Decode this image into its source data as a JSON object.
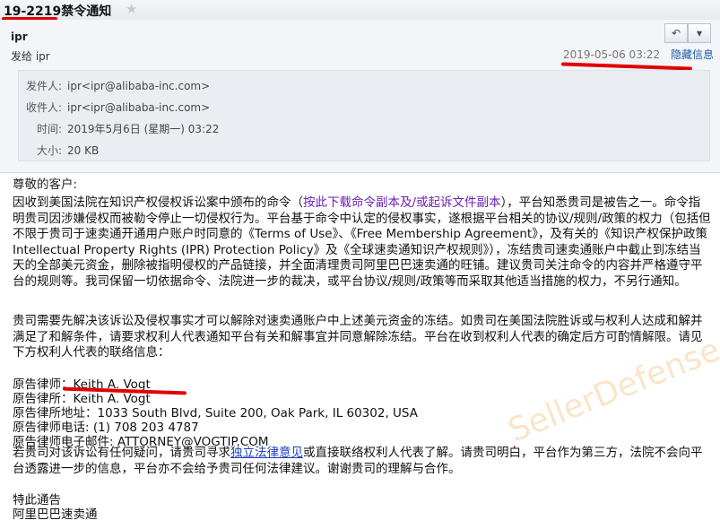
{
  "subject": "19-2219禁令通知",
  "sender_name": "ipr",
  "from_label": "发给 ipr",
  "date_short": "2019-05-06 03:22",
  "hide_info": "隐藏信息",
  "details": {
    "from_key": "发件人:",
    "from_val": "ipr<ipr@alibaba-inc.com>",
    "to_key": "收件人:",
    "to_val": "ipr<ipr@alibaba-inc.com>",
    "time_key": "时间:",
    "time_val": "2019年5月6日 (星期一) 03:22",
    "size_key": "大小:",
    "size_val": "20 KB"
  },
  "greeting": "尊敬的客户:",
  "para1_a": "因收到美国法院在知识产权侵权诉讼案中颁布的命令（",
  "para1_link": "按此下载命令副本及/或起诉文件副本",
  "para1_b": "），平台知悉贵司是被告之一。命令指明贵司因涉嫌侵权而被勒令停止一切侵权行为。平台基于命令中认定的侵权事实，遂根据平台相关的协议/规则/政策的权力（包括但不限于贵司于速卖通开通用户账户时同意的《Terms of Use》、《Free Membership Agreement》，及有关的《知识产权保护政策Intellectual Property Rights (IPR) Protection Policy》及《全球速卖通知识产权规则》），冻结贵司速卖通账户中截止到冻结当天的全部美元资金，删除被指明侵权的产品链接，并全面清理贵司阿里巴巴速卖通的旺铺。建议贵司关注命令的内容并严格遵守平台的规则等。我司保留一切依据命令、法院进一步的裁决，或平台协议/规则/政策等而采取其他适当措施的权力，不另行通知。",
  "para2": "贵司需要先解决该诉讼及侵权事实才可以解除对速卖通账户中上述美元资金的冻结。如贵司在美国法院胜诉或与权利人达成和解并满足了和解条件，请要求权利人代表通知平台有关和解事宜并同意解除冻结。平台在收到权利人代表的确定后方可酌情解限。请见下方权利人代表的联络信息：",
  "contact": {
    "lawyer": "原告律师：Keith A. Vogt",
    "firm": "原告律所：Keith A. Vogt",
    "address": "原告律所地址：1033 South Blvd, Suite 200, Oak Park, IL 60302, USA",
    "phone": "原告律师电话: (1) 708 203 4787",
    "email": "原告律师电子邮件: ATTORNEY@VOGTIP.COM"
  },
  "para3_a": "若贵司对该诉讼有任何疑问，请贵司寻求",
  "para3_link": "独立法律意见",
  "para3_b": "或直接联络权利人代表了解。请贵司明白，平台作为第三方，法院不会向平台透露进一步的信息，平台亦不会给予贵司任何法律建议。谢谢贵司的理解与合作。",
  "closing1": "特此通告",
  "closing2": "阿里巴巴速卖通",
  "watermark": "SellerDefense"
}
